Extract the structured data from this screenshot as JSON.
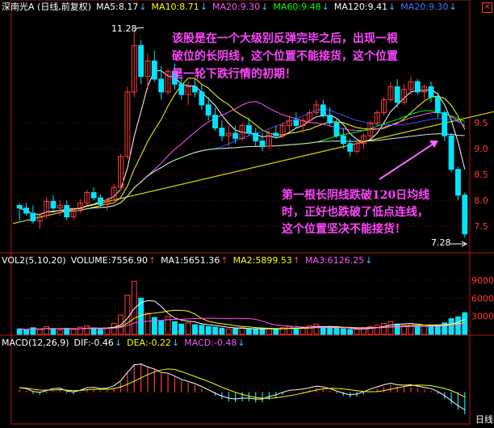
{
  "window": {
    "close_icon": "close-icon",
    "corner_label": "日线"
  },
  "price_header": {
    "title": "深南光A (日线,前复权)",
    "items": [
      {
        "text": "MA5:8.17",
        "color": "#ffffff",
        "arrow": "↓"
      },
      {
        "text": "MA10:8.71",
        "color": "#ffff00",
        "arrow": "↓"
      },
      {
        "text": "MA20:9.30",
        "color": "#ff55ff",
        "arrow": "↓"
      },
      {
        "text": "MA60:9.48",
        "color": "#00ff00",
        "arrow": "↓"
      },
      {
        "text": "MA120:9.41",
        "color": "#ffffff",
        "arrow": "↓"
      },
      {
        "text": "MA20:9.30",
        "color": "#4477ff",
        "arrow": "↓"
      }
    ]
  },
  "volume_header": {
    "items": [
      {
        "text": "VOL2(5,10,20)",
        "color": "#ffffff",
        "arrow": ""
      },
      {
        "text": "VOLUME:7556.90",
        "color": "#ffffff",
        "arrow": "↑"
      },
      {
        "text": "MA1:5651.36",
        "color": "#ffffff",
        "arrow": "↑"
      },
      {
        "text": "MA2:5899.53",
        "color": "#ffff00",
        "arrow": "↑"
      },
      {
        "text": "MA3:6126.25",
        "color": "#ff55ff",
        "arrow": "↓"
      }
    ]
  },
  "macd_header": {
    "items": [
      {
        "text": "MACD(12,26,9)",
        "color": "#ffffff",
        "arrow": ""
      },
      {
        "text": "DIF:-0.46",
        "color": "#ffffff",
        "arrow": "↓"
      },
      {
        "text": "DEA:-0.22",
        "color": "#ffff00",
        "arrow": "↓"
      },
      {
        "text": "MACD:-0.48",
        "color": "#ff55ff",
        "arrow": "↓"
      }
    ]
  },
  "annotations": {
    "top_note": [
      "该股是在一个大级别反弹完毕之后，出现一根",
      "破位的长阴线，这个位置不能接货，这个位置",
      "是一轮下跌行情的初期！"
    ],
    "bottom_note": [
      "第一根长阴线跌破120日均线",
      "时，正好也跌破了低点连线，",
      "这个位置坚决不能接货！"
    ],
    "high_label": "11.28",
    "low_label": "7.28"
  },
  "colors": {
    "background": "#000000",
    "frame": "#b0171a",
    "up": "#ff3b3b",
    "down": "#00e5ff",
    "grid": "#8b0000",
    "axis_text": "#ff3b3b",
    "note_text": "#ff44ff",
    "trend_line": "#d8d800",
    "arrow": "#ff66ff"
  },
  "chart_data": [
    {
      "type": "candlestick",
      "title": "深南光A (日线,前复权)",
      "y_ticks": [
        "9.5",
        "9.0",
        "8.5",
        "8.0",
        "7.5"
      ],
      "ylim": [
        7.0,
        11.6
      ],
      "grid": true,
      "candles": [
        [
          7.9,
          7.95,
          7.6,
          7.85
        ],
        [
          7.85,
          7.95,
          7.7,
          7.75
        ],
        [
          7.75,
          7.9,
          7.55,
          7.6
        ],
        [
          7.6,
          7.75,
          7.45,
          7.7
        ],
        [
          7.7,
          8.05,
          7.65,
          7.98
        ],
        [
          7.98,
          8.1,
          7.8,
          7.85
        ],
        [
          7.85,
          8.0,
          7.7,
          7.9
        ],
        [
          7.9,
          8.0,
          7.62,
          7.68
        ],
        [
          7.68,
          7.85,
          7.62,
          7.8
        ],
        [
          7.8,
          8.02,
          7.75,
          7.95
        ],
        [
          7.95,
          8.2,
          7.9,
          8.15
        ],
        [
          8.15,
          8.25,
          8.0,
          8.05
        ],
        [
          8.05,
          8.12,
          7.85,
          7.92
        ],
        [
          7.92,
          8.05,
          7.8,
          8.0
        ],
        [
          8.0,
          8.32,
          7.98,
          8.25
        ],
        [
          8.25,
          8.9,
          8.2,
          8.85
        ],
        [
          8.85,
          10.2,
          8.8,
          10.1
        ],
        [
          10.1,
          11.28,
          10.0,
          11.0
        ],
        [
          11.0,
          11.1,
          10.25,
          10.4
        ],
        [
          10.4,
          10.85,
          10.15,
          10.7
        ],
        [
          10.7,
          10.9,
          10.3,
          10.35
        ],
        [
          10.35,
          10.6,
          9.95,
          10.1
        ],
        [
          10.1,
          10.55,
          10.05,
          10.5
        ],
        [
          10.5,
          10.65,
          10.15,
          10.25
        ],
        [
          10.25,
          10.4,
          9.95,
          10.05
        ],
        [
          10.05,
          10.3,
          9.85,
          10.2
        ],
        [
          10.2,
          10.35,
          10.0,
          10.1
        ],
        [
          10.1,
          10.25,
          9.75,
          9.85
        ],
        [
          9.85,
          10.0,
          9.55,
          9.65
        ],
        [
          9.65,
          9.8,
          9.35,
          9.4
        ],
        [
          9.4,
          9.55,
          9.15,
          9.25
        ],
        [
          9.25,
          9.45,
          9.05,
          9.3
        ],
        [
          9.3,
          9.45,
          9.1,
          9.2
        ],
        [
          9.2,
          9.5,
          9.15,
          9.45
        ],
        [
          9.45,
          9.6,
          9.25,
          9.3
        ],
        [
          9.3,
          9.4,
          9.05,
          9.15
        ],
        [
          9.15,
          9.3,
          8.95,
          9.05
        ],
        [
          9.05,
          9.35,
          9.0,
          9.3
        ],
        [
          9.3,
          9.45,
          9.2,
          9.25
        ],
        [
          9.25,
          9.5,
          9.2,
          9.45
        ],
        [
          9.45,
          9.65,
          9.35,
          9.55
        ],
        [
          9.55,
          9.7,
          9.4,
          9.45
        ],
        [
          9.45,
          9.6,
          9.3,
          9.55
        ],
        [
          9.55,
          9.75,
          9.5,
          9.7
        ],
        [
          9.7,
          9.95,
          9.65,
          9.85
        ],
        [
          9.85,
          9.95,
          9.6,
          9.65
        ],
        [
          9.65,
          9.8,
          9.45,
          9.5
        ],
        [
          9.5,
          9.6,
          9.2,
          9.25
        ],
        [
          9.25,
          9.4,
          9.0,
          9.1
        ],
        [
          9.1,
          9.2,
          8.85,
          8.95
        ],
        [
          8.95,
          9.15,
          8.9,
          9.1
        ],
        [
          9.1,
          9.3,
          9.0,
          9.25
        ],
        [
          9.25,
          9.55,
          9.2,
          9.5
        ],
        [
          9.5,
          9.75,
          9.45,
          9.7
        ],
        [
          9.7,
          10.0,
          9.65,
          9.95
        ],
        [
          9.95,
          10.3,
          9.9,
          10.2
        ],
        [
          10.2,
          10.35,
          9.8,
          9.9
        ],
        [
          9.9,
          10.25,
          9.85,
          10.15
        ],
        [
          10.15,
          10.4,
          10.05,
          10.3
        ],
        [
          10.3,
          10.35,
          10.05,
          10.1
        ],
        [
          10.1,
          10.25,
          9.95,
          10.2
        ],
        [
          10.2,
          10.3,
          9.9,
          10.0
        ],
        [
          10.0,
          10.1,
          9.6,
          9.7
        ],
        [
          9.7,
          9.75,
          9.15,
          9.25
        ],
        [
          9.25,
          9.3,
          8.55,
          8.6
        ],
        [
          8.6,
          8.65,
          8.0,
          8.1
        ],
        [
          8.1,
          8.15,
          7.28,
          7.35
        ]
      ],
      "ma_series": [
        {
          "name": "MA5",
          "color": "#ffffff"
        },
        {
          "name": "MA10",
          "color": "#ffff00"
        },
        {
          "name": "MA20",
          "color": "#ff55ff"
        },
        {
          "name": "MA60",
          "color": "#00ff00"
        },
        {
          "name": "MA120",
          "color": "#ffffff"
        }
      ]
    },
    {
      "type": "bar",
      "title": "VOL2(5,10,20)",
      "y_ticks": [
        "9000",
        "6000",
        "3000"
      ],
      "ylim": [
        0,
        11000
      ],
      "values": [
        900,
        700,
        1100,
        800,
        1300,
        900,
        700,
        1000,
        800,
        1200,
        1400,
        900,
        800,
        1000,
        1800,
        3200,
        6500,
        8800,
        6000,
        3500,
        2800,
        2200,
        3000,
        2100,
        1700,
        1900,
        1600,
        1500,
        1300,
        1200,
        1000,
        900,
        950,
        1100,
        900,
        800,
        850,
        1000,
        900,
        1100,
        1300,
        1000,
        1100,
        1400,
        1700,
        1200,
        1100,
        1000,
        900,
        800,
        850,
        1000,
        1300,
        1500,
        1800,
        2100,
        1700,
        1500,
        1800,
        1400,
        1300,
        1200,
        1500,
        1900,
        2600,
        2900,
        3600
      ],
      "series": [
        {
          "name": "MA1",
          "color": "#ffffff"
        },
        {
          "name": "MA2",
          "color": "#ffff00"
        },
        {
          "name": "MA3",
          "color": "#ff55ff"
        }
      ]
    },
    {
      "type": "bar",
      "title": "MACD(12,26,9)",
      "ylim": [
        -0.6,
        0.9
      ],
      "macd": [
        0.05,
        0.03,
        -0.04,
        -0.06,
        -0.02,
        0.03,
        0.04,
        -0.03,
        -0.05,
        -0.01,
        0.05,
        0.06,
        0.03,
        0.04,
        0.1,
        0.22,
        0.42,
        0.6,
        0.62,
        0.55,
        0.5,
        0.42,
        0.4,
        0.33,
        0.25,
        0.2,
        0.15,
        0.08,
        0.0,
        -0.08,
        -0.15,
        -0.2,
        -0.22,
        -0.2,
        -0.2,
        -0.22,
        -0.22,
        -0.16,
        -0.12,
        -0.06,
        -0.01,
        0.0,
        0.02,
        0.05,
        0.09,
        0.07,
        0.03,
        -0.03,
        -0.08,
        -0.12,
        -0.1,
        -0.05,
        0.02,
        0.07,
        0.12,
        0.16,
        0.12,
        0.11,
        0.12,
        0.09,
        0.06,
        0.03,
        -0.04,
        -0.14,
        -0.26,
        -0.38,
        -0.48
      ],
      "series": [
        {
          "name": "DIF",
          "color": "#ffffff"
        },
        {
          "name": "DEA",
          "color": "#ffff00"
        },
        {
          "name": "MACD",
          "color": "#ff55ff"
        }
      ]
    }
  ]
}
